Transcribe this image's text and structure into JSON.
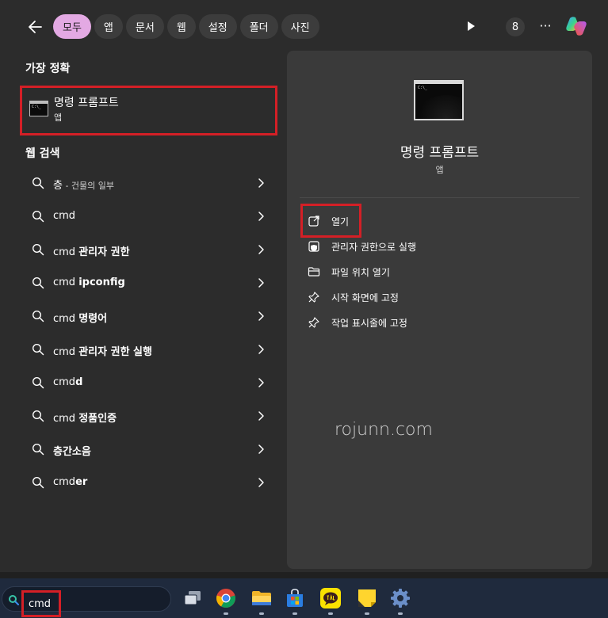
{
  "header": {
    "filters": [
      {
        "label": "모두",
        "active": true
      },
      {
        "label": "앱",
        "active": false
      },
      {
        "label": "문서",
        "active": false
      },
      {
        "label": "웹",
        "active": false
      },
      {
        "label": "설정",
        "active": false
      },
      {
        "label": "폴더",
        "active": false
      },
      {
        "label": "사진",
        "active": false
      }
    ],
    "badge_count": "8",
    "more_label": "···"
  },
  "best_match": {
    "section_title": "가장 정확",
    "title": "명령 프롬프트",
    "subtitle": "앱"
  },
  "web_search": {
    "section_title": "웹 검색",
    "items": [
      {
        "plain": "층",
        "bold": "",
        "suffix": " - 건물의 일부"
      },
      {
        "plain": "cmd",
        "bold": "",
        "suffix": ""
      },
      {
        "plain": "cmd ",
        "bold": "관리자 권한",
        "suffix": ""
      },
      {
        "plain": "cmd ",
        "bold": "ipconfig",
        "suffix": ""
      },
      {
        "plain": "cmd ",
        "bold": "명령어",
        "suffix": ""
      },
      {
        "plain": "cmd ",
        "bold": "관리자 권한 실행",
        "suffix": ""
      },
      {
        "plain": "cmd",
        "bold": "d",
        "suffix": ""
      },
      {
        "plain": "cmd ",
        "bold": "정품인증",
        "suffix": ""
      },
      {
        "plain": "",
        "bold": "층간소음",
        "suffix": ""
      },
      {
        "plain": "cmd",
        "bold": "er",
        "suffix": ""
      }
    ]
  },
  "preview": {
    "app_name": "명령 프롬프트",
    "app_kind": "앱",
    "actions": [
      {
        "label": "열기",
        "icon": "open-external-icon"
      },
      {
        "label": "관리자 권한으로 실행",
        "icon": "shield-admin-icon"
      },
      {
        "label": "파일 위치 열기",
        "icon": "folder-icon"
      },
      {
        "label": "시작 화면에 고정",
        "icon": "pin-icon"
      },
      {
        "label": "작업 표시줄에 고정",
        "icon": "pin-icon"
      }
    ]
  },
  "watermark": "rojunn.com",
  "taskbar": {
    "search_value": "cmd",
    "apps": [
      "task-view-icon",
      "chrome-icon",
      "file-explorer-icon",
      "microsoft-store-icon",
      "kakaotalk-icon",
      "sticky-notes-icon",
      "settings-icon"
    ]
  },
  "colors": {
    "accent_chip": "#e3a9e3",
    "highlight_box": "#d41f26",
    "panel": "#2c2c2c",
    "preview_pane": "#3a3a3a",
    "taskbar": "#1f2a3d"
  }
}
